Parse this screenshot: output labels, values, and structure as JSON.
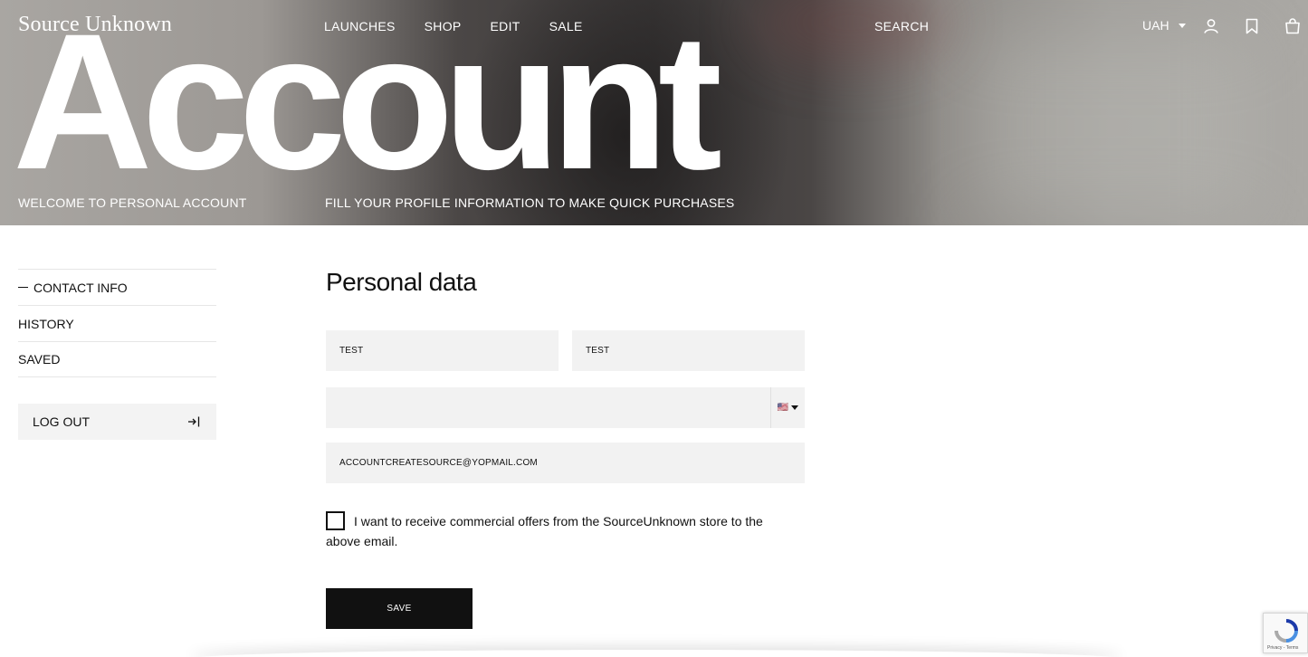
{
  "header": {
    "logo": "Source Unknown",
    "nav": [
      "LAUNCHES",
      "SHOP",
      "EDIT",
      "SALE"
    ],
    "search_label": "SEARCH",
    "currency": "UAH",
    "icons": [
      "user-icon",
      "bookmark-icon",
      "bag-icon"
    ]
  },
  "hero": {
    "title": "Account",
    "welcome": "WELCOME TO PERSONAL ACCOUNT",
    "subtitle": "FILL YOUR PROFILE INFORMATION TO MAKE QUICK PURCHASES"
  },
  "sidebar": {
    "items": [
      {
        "label": "CONTACT INFO",
        "active": true
      },
      {
        "label": "HISTORY",
        "active": false
      },
      {
        "label": "SAVED",
        "active": false
      }
    ],
    "logout": "LOG OUT"
  },
  "form": {
    "title": "Personal data",
    "first_name": "TEST",
    "last_name": "TEST",
    "phone": "",
    "phone_country_flag": "🇺🇸",
    "email": "ACCOUNTCREATESOURCE@YOPMAIL.COM",
    "consent_checked": false,
    "consent_text": "I want to receive commercial offers from the SourceUnknown store to the above email.",
    "save_label": "SAVE"
  },
  "recaptcha": {
    "footer": "Privacy - Terms"
  },
  "colors": {
    "button_bg": "#111111",
    "field_bg": "#f2f2f2"
  }
}
